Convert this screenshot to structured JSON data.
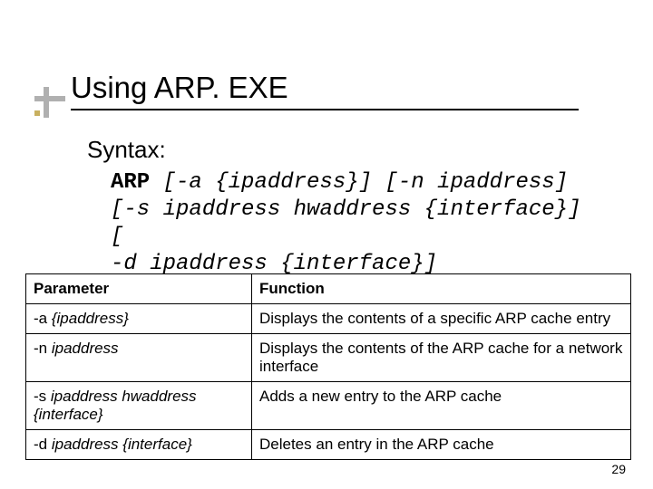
{
  "title": "Using ARP. EXE",
  "syntax_label": "Syntax:",
  "syntax": {
    "cmd": "ARP",
    "lines": [
      "[-a {ipaddress}] [-n ipaddress]",
      "[-s ipaddress hwaddress {interface}]   [",
      "-d ipaddress {interface}]"
    ]
  },
  "table": {
    "headers": [
      "Parameter",
      "Function"
    ],
    "rows": [
      {
        "param_prefix": "-a ",
        "param_ital": "{ipaddress}",
        "func": "Displays the contents of a specific ARP cache entry"
      },
      {
        "param_prefix": "-n ",
        "param_ital": "ipaddress",
        "func": "Displays the contents of the ARP cache for a network interface"
      },
      {
        "param_prefix": "-s ",
        "param_ital": "ipaddress hwaddress {interface}",
        "func": "Adds a new entry to the ARP cache"
      },
      {
        "param_prefix": "-d ",
        "param_ital": "ipaddress {interface}",
        "func": "Deletes an entry in the ARP cache"
      }
    ]
  },
  "page_number": "29"
}
